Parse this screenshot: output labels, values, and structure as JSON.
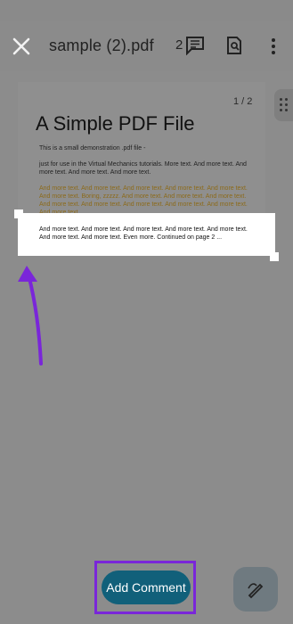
{
  "header": {
    "title": "sample (2).pdf",
    "comment_count": "2",
    "close_icon": "close-icon",
    "comment_icon": "comment-icon",
    "find_icon": "find-icon",
    "more_icon": "more-icon"
  },
  "document": {
    "page_indicator": "1 / 2",
    "title": "A Simple PDF File",
    "line1": "This is a small demonstration .pdf file -",
    "para1": "just for use in the Virtual Mechanics tutorials. More text. And more text. And more text. And more text. And more text.",
    "para2": "And more text. And more text. And more text. And more text. And more text. And more text. Boring, zzzzz. And more text. And more text. And more text. And more text. And more text. And more text. And more text. And more text. And more text.",
    "selected_para": "And more text. And more text. And more text. And more text. And more text. And more text. And more text. Even more. Continued on page 2 ..."
  },
  "actions": {
    "add_comment": "Add Comment",
    "draw_icon": "annotate-pen-icon"
  },
  "colors": {
    "accent": "#11607a",
    "highlight_frame": "#7a26d9",
    "arrow": "#7a26d9"
  }
}
